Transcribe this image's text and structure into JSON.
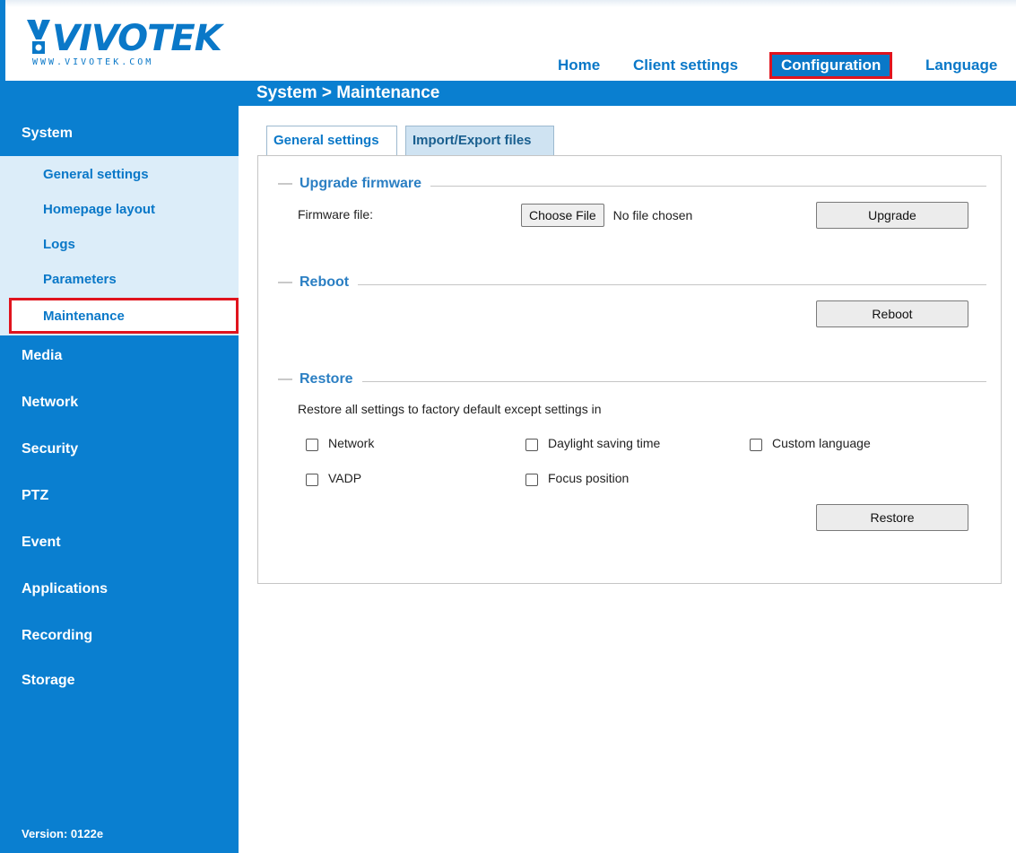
{
  "brand": {
    "logo_word": "VIVOTEK",
    "logo_url": "WWW.VIVOTEK.COM",
    "accent": "#0a7fd0",
    "highlight": "#e0141e"
  },
  "topnav": {
    "home": "Home",
    "client_settings": "Client settings",
    "configuration": "Configuration",
    "language": "Language"
  },
  "breadcrumb": "System  > Maintenance",
  "sidebar": {
    "system": "System",
    "system_items": [
      "General settings",
      "Homepage layout",
      "Logs",
      "Parameters",
      "Maintenance"
    ],
    "active_item": "Maintenance",
    "categories": [
      "Media",
      "Network",
      "Security",
      "PTZ",
      "Event",
      "Applications",
      "Recording",
      "Storage"
    ],
    "version": "Version: 0122e"
  },
  "tabs": [
    "General settings",
    "Import/Export files"
  ],
  "upgrade": {
    "heading": "Upgrade firmware",
    "field_label": "Firmware file:",
    "choose_file": "Choose File",
    "no_file": "No file chosen",
    "button": "Upgrade"
  },
  "reboot": {
    "heading": "Reboot",
    "button": "Reboot"
  },
  "restore": {
    "heading": "Restore",
    "description": "Restore all settings to factory default except settings in",
    "options": [
      "Network",
      "Daylight saving time",
      "Custom language",
      "VADP",
      "Focus position"
    ],
    "button": "Restore"
  }
}
